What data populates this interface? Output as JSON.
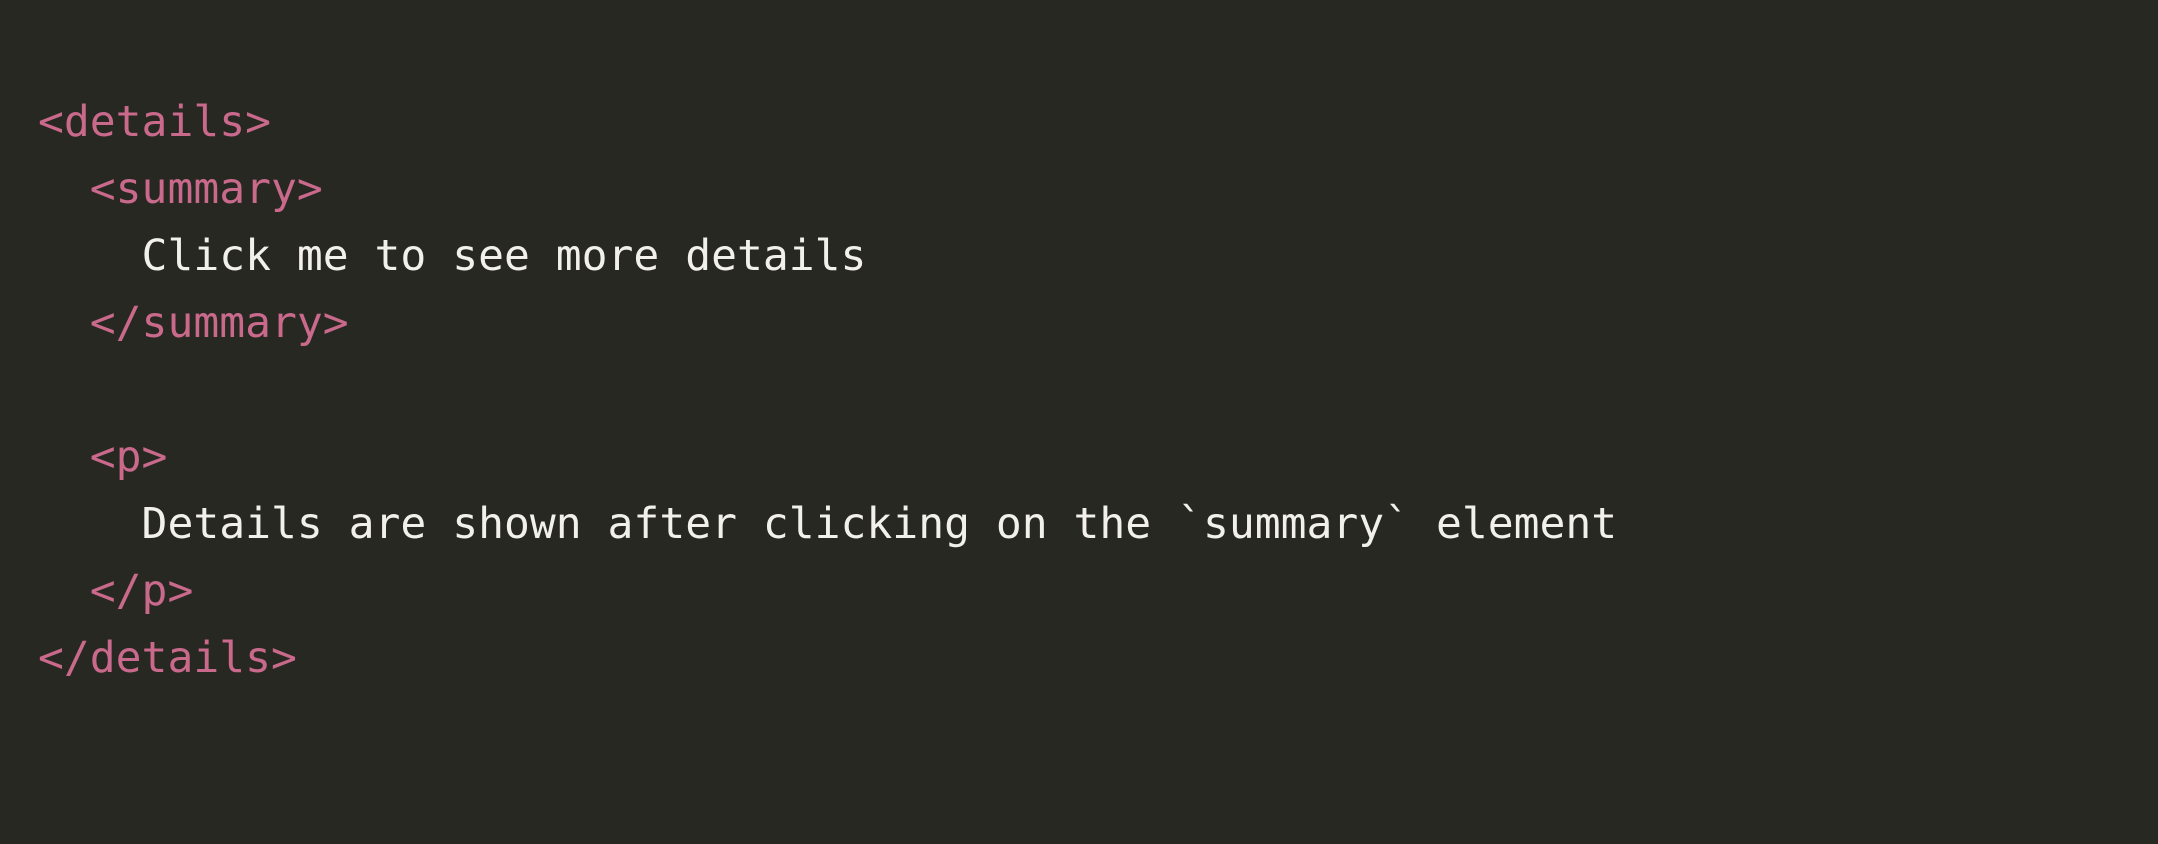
{
  "code_block": {
    "language": "html",
    "theme": {
      "background": "#272822",
      "tag_color": "#c9698c",
      "text_color": "#f2f0eb"
    },
    "lines": [
      {
        "indent": "",
        "type": "tag",
        "text": "<details>"
      },
      {
        "indent": "  ",
        "type": "tag",
        "text": "<summary>"
      },
      {
        "indent": "    ",
        "type": "text",
        "text": "Click me to see more details"
      },
      {
        "indent": "  ",
        "type": "tag",
        "text": "</summary>"
      },
      {
        "indent": "",
        "type": "blank",
        "text": ""
      },
      {
        "indent": "  ",
        "type": "tag",
        "text": "<p>"
      },
      {
        "indent": "    ",
        "type": "text",
        "text": "Details are shown after clicking on the `summary` element"
      },
      {
        "indent": "  ",
        "type": "tag",
        "text": "</p>"
      },
      {
        "indent": "",
        "type": "tag",
        "text": "</details>"
      }
    ]
  }
}
